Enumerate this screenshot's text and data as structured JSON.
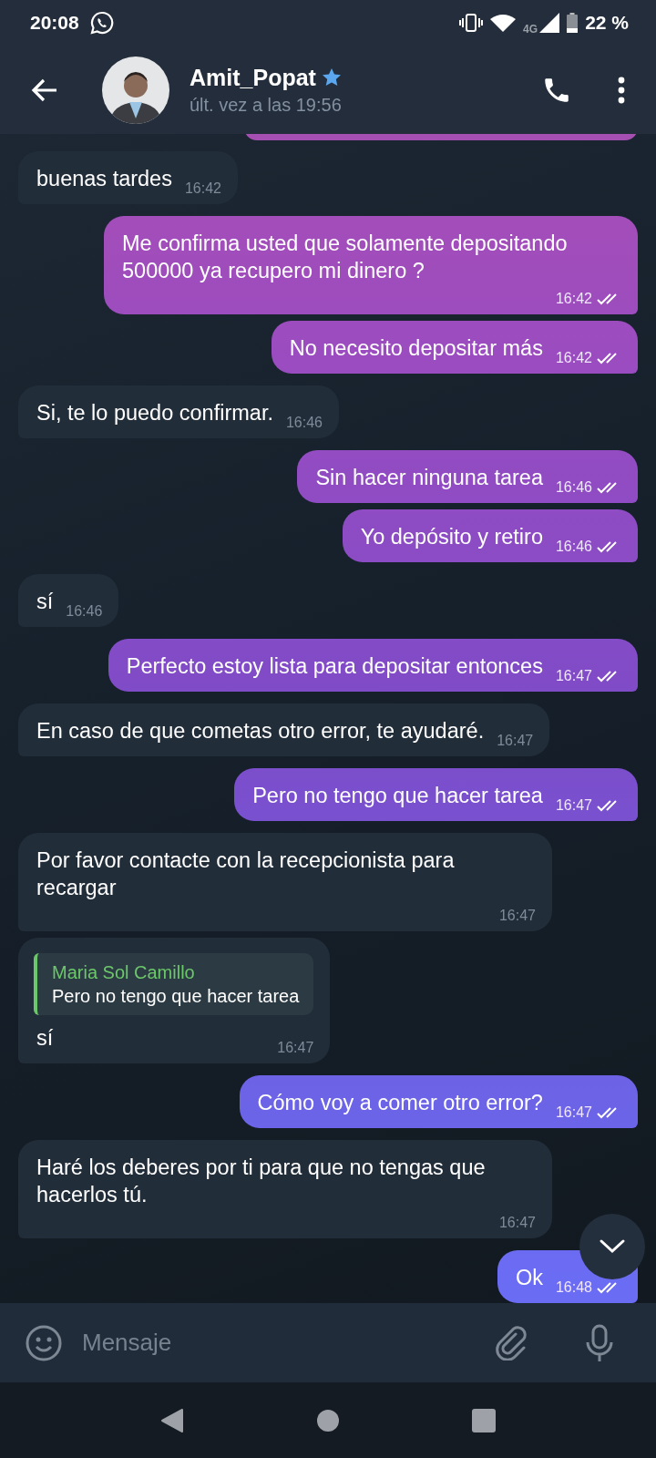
{
  "status_bar": {
    "time": "20:08",
    "network": "4G",
    "battery": "22 %"
  },
  "header": {
    "name": "Amit_Popat",
    "starred": true,
    "last_seen": "últ. vez a las 19:56"
  },
  "messages": [
    {
      "kind": "in",
      "text": "buenas tardes",
      "time": "16:42"
    },
    {
      "kind": "out",
      "text": "Me confirma usted que solamente depositando 500000 ya recupero mi dinero ?",
      "time": "16:42",
      "read": true
    },
    {
      "kind": "out",
      "text": "No necesito depositar más",
      "time": "16:42",
      "read": true
    },
    {
      "kind": "in",
      "text": "Si, te lo puedo confirmar.",
      "time": "16:46"
    },
    {
      "kind": "out",
      "text": "Sin hacer ninguna tarea",
      "time": "16:46",
      "read": true
    },
    {
      "kind": "out",
      "text": "Yo depósito y retiro",
      "time": "16:46",
      "read": true
    },
    {
      "kind": "in",
      "text": "sí",
      "time": "16:46"
    },
    {
      "kind": "out",
      "text": "Perfecto estoy lista para depositar entonces",
      "time": "16:47",
      "read": true
    },
    {
      "kind": "in",
      "text": "En caso de que cometas otro error, te ayudaré.",
      "time": "16:47"
    },
    {
      "kind": "out",
      "text": "Pero no tengo que hacer tarea",
      "time": "16:47",
      "read": true
    },
    {
      "kind": "in",
      "text": "Por favor contacte con la recepcionista para recargar",
      "time": "16:47"
    },
    {
      "kind": "in",
      "reply": {
        "name": "Maria Sol Camillo",
        "text": "Pero no tengo que hacer tarea"
      },
      "text": "sí",
      "time": "16:47"
    },
    {
      "kind": "out",
      "text": "Cómo voy a comer otro error?",
      "time": "16:47",
      "read": true
    },
    {
      "kind": "in",
      "text": "Haré los deberes por ti para que no tengas que hacerlos tú.",
      "time": "16:47"
    },
    {
      "kind": "out",
      "text": "Ok",
      "time": "16:48",
      "read": true
    }
  ],
  "composer": {
    "placeholder": "Mensaje"
  }
}
